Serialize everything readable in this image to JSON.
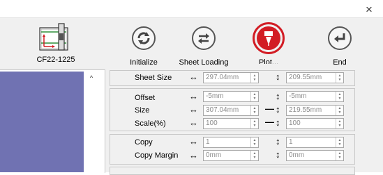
{
  "window": {
    "close_glyph": "×"
  },
  "device": {
    "label": "CF22-1225",
    "icon": "cutting-plotter-icon"
  },
  "toolbar": {
    "buttons": [
      {
        "label": "Initialize",
        "icon": "refresh-icon"
      },
      {
        "label": "Sheet Loading",
        "icon": "swap-arrows-icon"
      },
      {
        "label": "Plot...",
        "icon": "pen-plot-icon",
        "highlight_color": "#d21c24"
      },
      {
        "label": "End",
        "icon": "return-arrow-icon"
      }
    ]
  },
  "list": {
    "selected_color": "#7072b2",
    "scroll_up_glyph": "^"
  },
  "settings": {
    "sheet_size": {
      "label": "Sheet Size",
      "width": "297.04mm",
      "height": "209.55mm"
    },
    "offset": {
      "label": "Offset",
      "x": "-5mm",
      "y": "-5mm"
    },
    "size": {
      "label": "Size",
      "x": "307.04mm",
      "y": "219.55mm"
    },
    "scale": {
      "label": "Scale(%)",
      "x": "100",
      "y": "100"
    },
    "copy": {
      "label": "Copy",
      "x": "1",
      "y": "1"
    },
    "copy_margin": {
      "label": "Copy Margin",
      "x": "0mm",
      "y": "0mm"
    }
  },
  "glyphs": {
    "horizontal": "↔",
    "vertical": "↕",
    "link": "—"
  }
}
